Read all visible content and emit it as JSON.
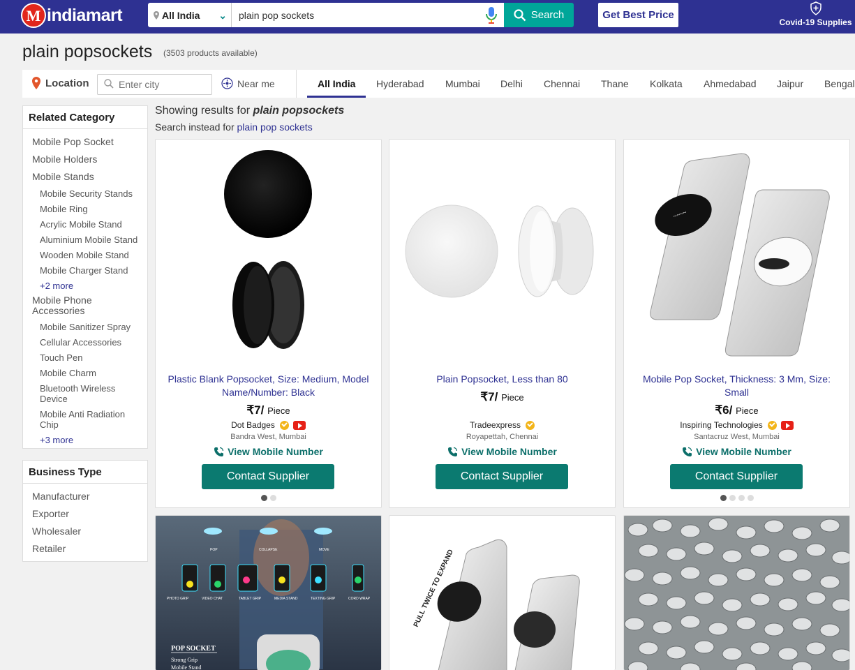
{
  "header": {
    "logo_letter": "M",
    "logo_text": "indiamart",
    "location_select": "All India",
    "search_value": "plain pop sockets",
    "search_button": "Search",
    "best_price_button": "Get Best Price",
    "covid_label": "Covid-19 Supplies"
  },
  "page": {
    "title": "plain popsockets",
    "product_count": "(3503 products available)"
  },
  "location_bar": {
    "label": "Location",
    "city_placeholder": "Enter city",
    "near_me": "Near me",
    "cities": [
      "All India",
      "Hyderabad",
      "Mumbai",
      "Delhi",
      "Chennai",
      "Thane",
      "Kolkata",
      "Ahmedabad",
      "Jaipur",
      "Bengal"
    ]
  },
  "sidebar": {
    "related_heading": "Related Category",
    "related": [
      "Mobile Pop Socket",
      "Mobile Holders",
      "Mobile Stands",
      "Mobile Security Stands",
      "Mobile Ring",
      "Acrylic Mobile Stand",
      "Aluminium Mobile Stand",
      "Wooden Mobile Stand",
      "Mobile Charger Stand",
      "+2 more",
      "Mobile Phone Accessories",
      "Mobile Sanitizer Spray",
      "Cellular Accessories",
      "Touch Pen",
      "Mobile Charm",
      "Bluetooth Wireless Device",
      "Mobile Anti Radiation Chip",
      "+3 more"
    ],
    "business_heading": "Business Type",
    "business": [
      "Manufacturer",
      "Exporter",
      "Wholesaler",
      "Retailer"
    ]
  },
  "results": {
    "showing_prefix": "Showing results for",
    "showing_query": "plain popsockets",
    "instead_prefix": "Search instead for",
    "instead_query": "plain pop sockets"
  },
  "products": [
    {
      "title": "Plastic Blank Popsocket, Size: Medium, Model Name/Number: Black",
      "price": "₹7/",
      "unit": "Piece",
      "supplier": "Dot Badges",
      "place": "Bandra West, Mumbai",
      "view_number": "View Mobile Number",
      "contact": "Contact Supplier"
    },
    {
      "title": "Plain Popsocket, Less than 80",
      "price": "₹7/",
      "unit": "Piece",
      "supplier": "Tradeexpress",
      "place": "Royapettah, Chennai",
      "view_number": "View Mobile Number",
      "contact": "Contact Supplier"
    },
    {
      "title": "Mobile Pop Socket, Thickness: 3 Mm, Size: Small",
      "price": "₹6/",
      "unit": "Piece",
      "supplier": "Inspiring Technologies",
      "place": "Santacruz West, Mumbai",
      "view_number": "View Mobile Number",
      "contact": "Contact Supplier"
    }
  ],
  "product4_image_text": {
    "labels": [
      "POP",
      "COLLAPSE",
      "MOVE",
      "PHOTO GRIP",
      "VIDEO CHAT",
      "TABLET GRIP",
      "MEDIA STAND",
      "TEXTING GRIP",
      "CORD WRAP"
    ],
    "brand": "POP SOCKET",
    "line1": "Strong Grip",
    "line2": "Mobile Stand"
  },
  "product5_image_text": "PULL TWICE TO EXPAND",
  "colors": {
    "header_bg": "#2e3192",
    "search_button": "#00a699",
    "contact_button": "#0b7a70"
  }
}
